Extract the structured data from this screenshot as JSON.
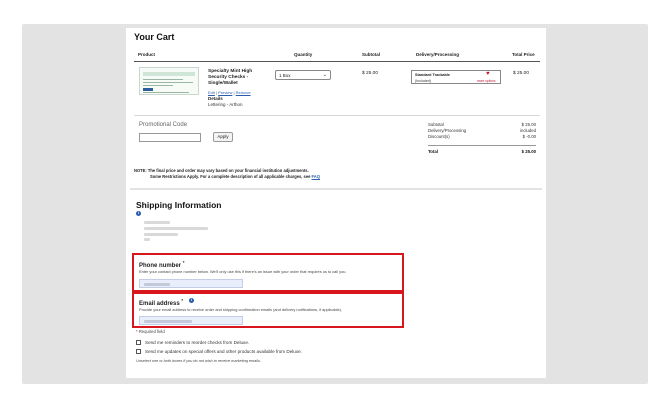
{
  "cart": {
    "title": "Your Cart",
    "columns": {
      "product": "Product",
      "quantity": "Quantity",
      "subtotal": "Subtotal",
      "delivery": "Delivery/Processing",
      "total": "Total Price"
    },
    "item": {
      "name": "Specialty Mint High Security Checks - Single/Wallet",
      "edit_link": "Edit",
      "preview_link": "Preview",
      "remove_link": "Remove",
      "details_label": "Details",
      "lettering": "Lettering - Arthon",
      "quantity": "1 Box",
      "subtotal": "$ 25.00",
      "delivery_name": "Standard Trackable",
      "delivery_included": "(Included)",
      "delivery_more": "more options",
      "total": "$ 25.00"
    },
    "promo": {
      "label": "Promotional Code",
      "input_value": "",
      "apply_label": "Apply"
    },
    "summary": {
      "subtotal_label": "Subtotal",
      "subtotal_value": "$ 25.00",
      "delivery_label": "Delivery/Processing",
      "delivery_value": "included",
      "discounts_label": "Discount(s)",
      "discounts_value": "$ -0.00",
      "total_label": "Total",
      "total_value": "$ 25.00"
    },
    "note": {
      "line1": "NOTE: The final price and order may vary based on your financial institution adjustments.",
      "line2_prefix": "Some Restrictions Apply. For a complete description of all applicable charges, see",
      "faq_link": "FAQ"
    }
  },
  "shipping": {
    "title": "Shipping Information",
    "phone": {
      "label": "Phone number",
      "required_mark": "*",
      "help": "Enter your contact phone number below. We'll only use this if there's an issue with your order that requires us to call you.",
      "value": ""
    },
    "email": {
      "label": "Email address",
      "required_mark": "*",
      "help": "Provide your email address to receive order and shipping confirmation emails (and delivery notifications, if applicable).",
      "value": ""
    },
    "required_note": "Required field",
    "checkbox_reminders": "Send me reminders to reorder checks from Deluxe.",
    "checkbox_updates": "Send me updates on special offers and other products available from Deluxe.",
    "checkbox_note": "Unselect one or both boxes if you do not wish to receive marketing emails."
  },
  "colors": {
    "highlight": "#d8161d",
    "link": "#2a5db0",
    "backdrop": "#e3e3e3"
  }
}
